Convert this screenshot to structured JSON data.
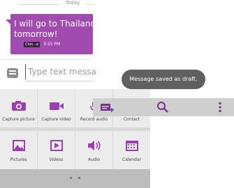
{
  "conversation": {
    "date_divider": "Today",
    "message": {
      "text_line1": "I will go to Thailand",
      "text_line2": "tomorrow!",
      "sim_label": "Chin...e",
      "time": "3:15 PM"
    }
  },
  "compose": {
    "placeholder": "Type text message"
  },
  "toast": {
    "text": "Message saved as draft."
  },
  "action_bar": {
    "icons": [
      "add-list-icon",
      "search-icon",
      "overflow-menu-icon"
    ]
  },
  "attachments": {
    "items": [
      {
        "label": "Capture picture",
        "icon": "camera-icon"
      },
      {
        "label": "Capture video",
        "icon": "video-camera-icon"
      },
      {
        "label": "Record audio",
        "icon": "microphone-icon"
      },
      {
        "label": "Contact",
        "icon": "contact-icon"
      },
      {
        "label": "Pictures",
        "icon": "picture-icon"
      },
      {
        "label": "Videos",
        "icon": "video-play-icon"
      },
      {
        "label": "Audio",
        "icon": "speaker-icon"
      },
      {
        "label": "Calendar",
        "icon": "calendar-icon"
      }
    ]
  },
  "colors": {
    "accent": "#a14bb0",
    "toast_bg": "#606060",
    "grid_bg": "#ececec",
    "action_bar_bg": "#cfcfcf"
  }
}
